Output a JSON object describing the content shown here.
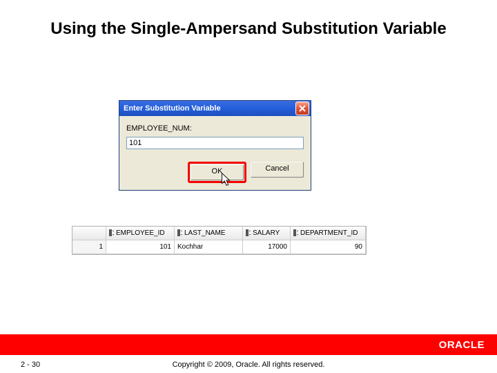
{
  "title": "Using the Single-Ampersand Substitution Variable",
  "dialog": {
    "title": "Enter Substitution Variable",
    "prompt": "EMPLOYEE_NUM:",
    "value": "101",
    "ok": "OK",
    "cancel": "Cancel"
  },
  "results": {
    "columns": [
      "EMPLOYEE_ID",
      "LAST_NAME",
      "SALARY",
      "DEPARTMENT_ID"
    ],
    "rows": [
      {
        "n": "1",
        "employee_id": "101",
        "last_name": "Kochhar",
        "salary": "17000",
        "department_id": "90"
      }
    ]
  },
  "footer": {
    "page": "2 - 30",
    "copyright": "Copyright © 2009, Oracle. All rights reserved.",
    "logo": "ORACLE"
  }
}
